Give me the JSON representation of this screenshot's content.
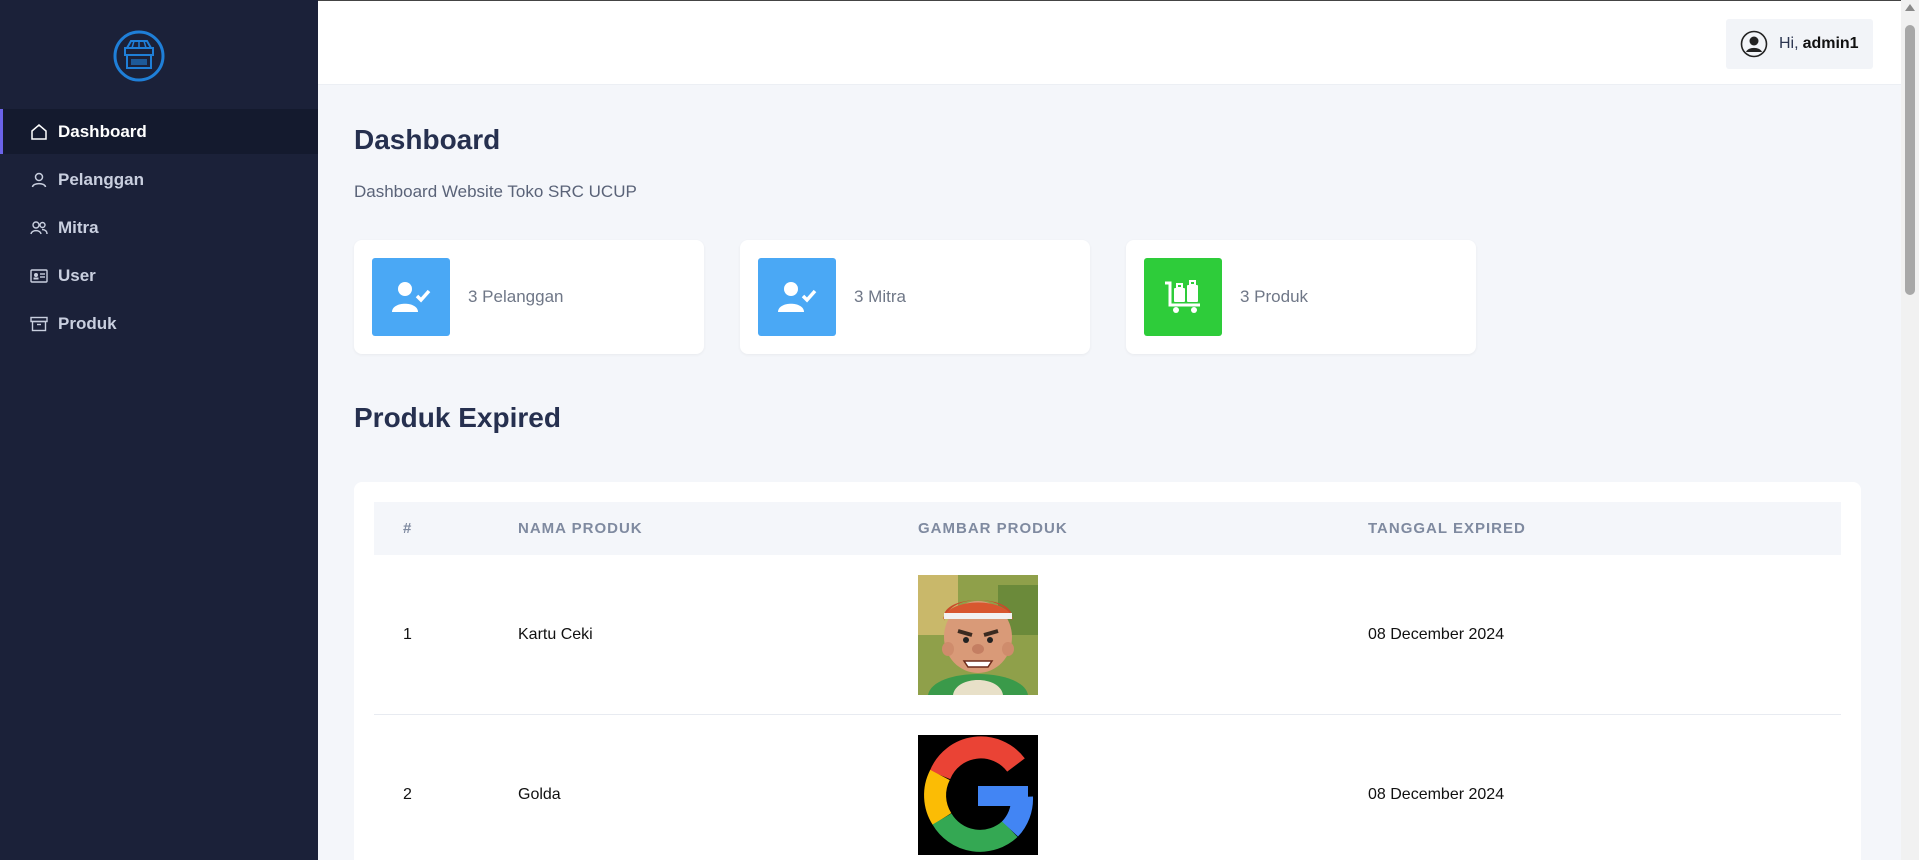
{
  "user": {
    "greeting": "Hi,",
    "name": "admin1"
  },
  "sidebar": {
    "items": [
      {
        "label": "Dashboard",
        "icon": "home-icon",
        "active": true
      },
      {
        "label": "Pelanggan",
        "icon": "user-icon"
      },
      {
        "label": "Mitra",
        "icon": "users-icon"
      },
      {
        "label": "User",
        "icon": "id-card-icon"
      },
      {
        "label": "Produk",
        "icon": "archive-icon"
      }
    ]
  },
  "page": {
    "title": "Dashboard",
    "subtitle": "Dashboard Website Toko SRC UCUP"
  },
  "stats": [
    {
      "label": "3 Pelanggan",
      "icon": "user-check-icon",
      "color": "#4aa8f5"
    },
    {
      "label": "3 Mitra",
      "icon": "user-check-icon",
      "color": "#4aa8f5"
    },
    {
      "label": "3 Produk",
      "icon": "luggage-cart-icon",
      "color": "#2ecc3a"
    }
  ],
  "expired": {
    "title": "Produk Expired",
    "columns": [
      "#",
      "Nama Produk",
      "Gambar Produk",
      "Tanggal Expired"
    ],
    "rows": [
      {
        "no": "1",
        "name": "Kartu Ceki",
        "image": "cartoon-character-image",
        "date": "08 December 2024"
      },
      {
        "no": "2",
        "name": "Golda",
        "image": "google-logo-image",
        "date": "08 December 2024"
      }
    ]
  },
  "colors": {
    "sidebar": "#1b2139",
    "accent": "#6b63e8",
    "blue": "#4aa8f5",
    "green": "#2ecc3a"
  }
}
